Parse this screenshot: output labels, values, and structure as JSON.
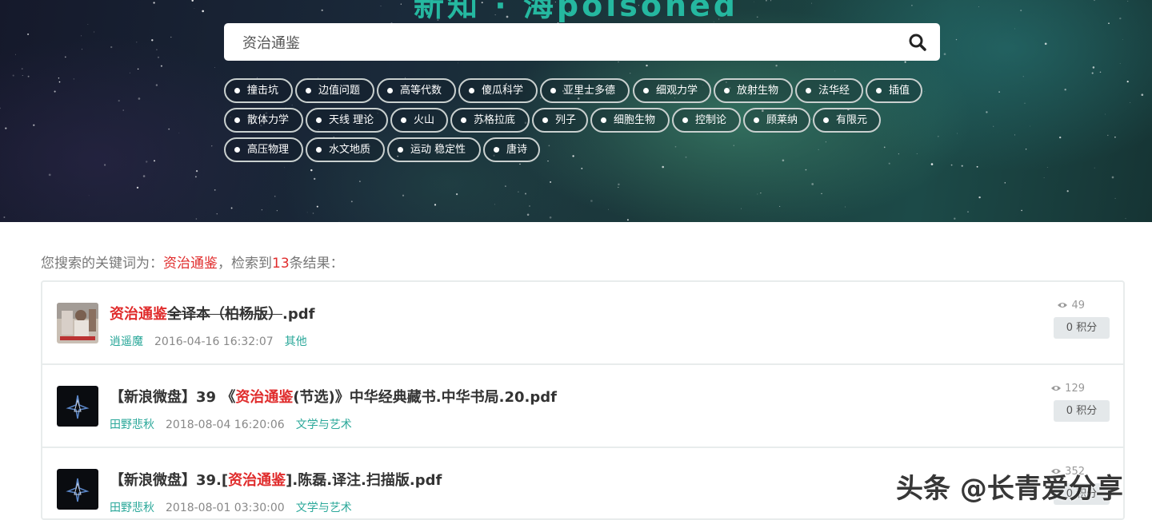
{
  "header": {
    "site_title": "新知 · 海poisoned",
    "search": {
      "value": "资治通鉴",
      "placeholder": ""
    },
    "tags": [
      [
        "撞击坑",
        "边值问题",
        "高等代数",
        "傻瓜科学",
        "亚里士多德",
        "细观力学",
        "放射生物",
        "法华经",
        "插值"
      ],
      [
        "散体力学",
        "天线 理论",
        "火山",
        "苏格拉底",
        "列子",
        "细胞生物",
        "控制论",
        "顾莱纳",
        "有限元"
      ],
      [
        "高压物理",
        "水文地质",
        "运动 稳定性",
        "唐诗"
      ]
    ]
  },
  "summary": {
    "prefix": "您搜索的关键词为：",
    "keyword": "资治通鉴",
    "middle": "，检索到",
    "count": "13",
    "suffix": "条结果："
  },
  "results": [
    {
      "title_highlight": "资治通鉴",
      "title_rest_struck": "全译本（柏杨版）",
      "title_ext": ".pdf",
      "author": "逍遥魔",
      "date": "2016-04-16 16:32:07",
      "category": "其他",
      "views": "49",
      "points": "0 积分",
      "thumb_icon": "book-cover-photo-icon"
    },
    {
      "title_prefix": "【新浪微盘】39 《",
      "title_highlight": "资治通鉴",
      "title_suffix": "(节选)》中华经典藏书.中华书局.20.pdf",
      "author": "田野悲秋",
      "date": "2018-08-04 16:20:06",
      "category": "文学与艺术",
      "views": "129",
      "points": "0 积分",
      "thumb_icon": "star-logo-icon"
    },
    {
      "title_prefix": "【新浪微盘】39.[",
      "title_highlight": "资治通鉴",
      "title_suffix": "].陈磊.译注.扫描版.pdf",
      "author": "田野悲秋",
      "date": "2018-08-01 03:30:00",
      "category": "文学与艺术",
      "views": "352",
      "points": "0 积分",
      "thumb_icon": "star-logo-icon"
    }
  ],
  "watermark": "头条 @长青爱分享",
  "colors": {
    "accent": "#2ba89a",
    "highlight": "#e02c2c",
    "title": "#25b8a0"
  }
}
